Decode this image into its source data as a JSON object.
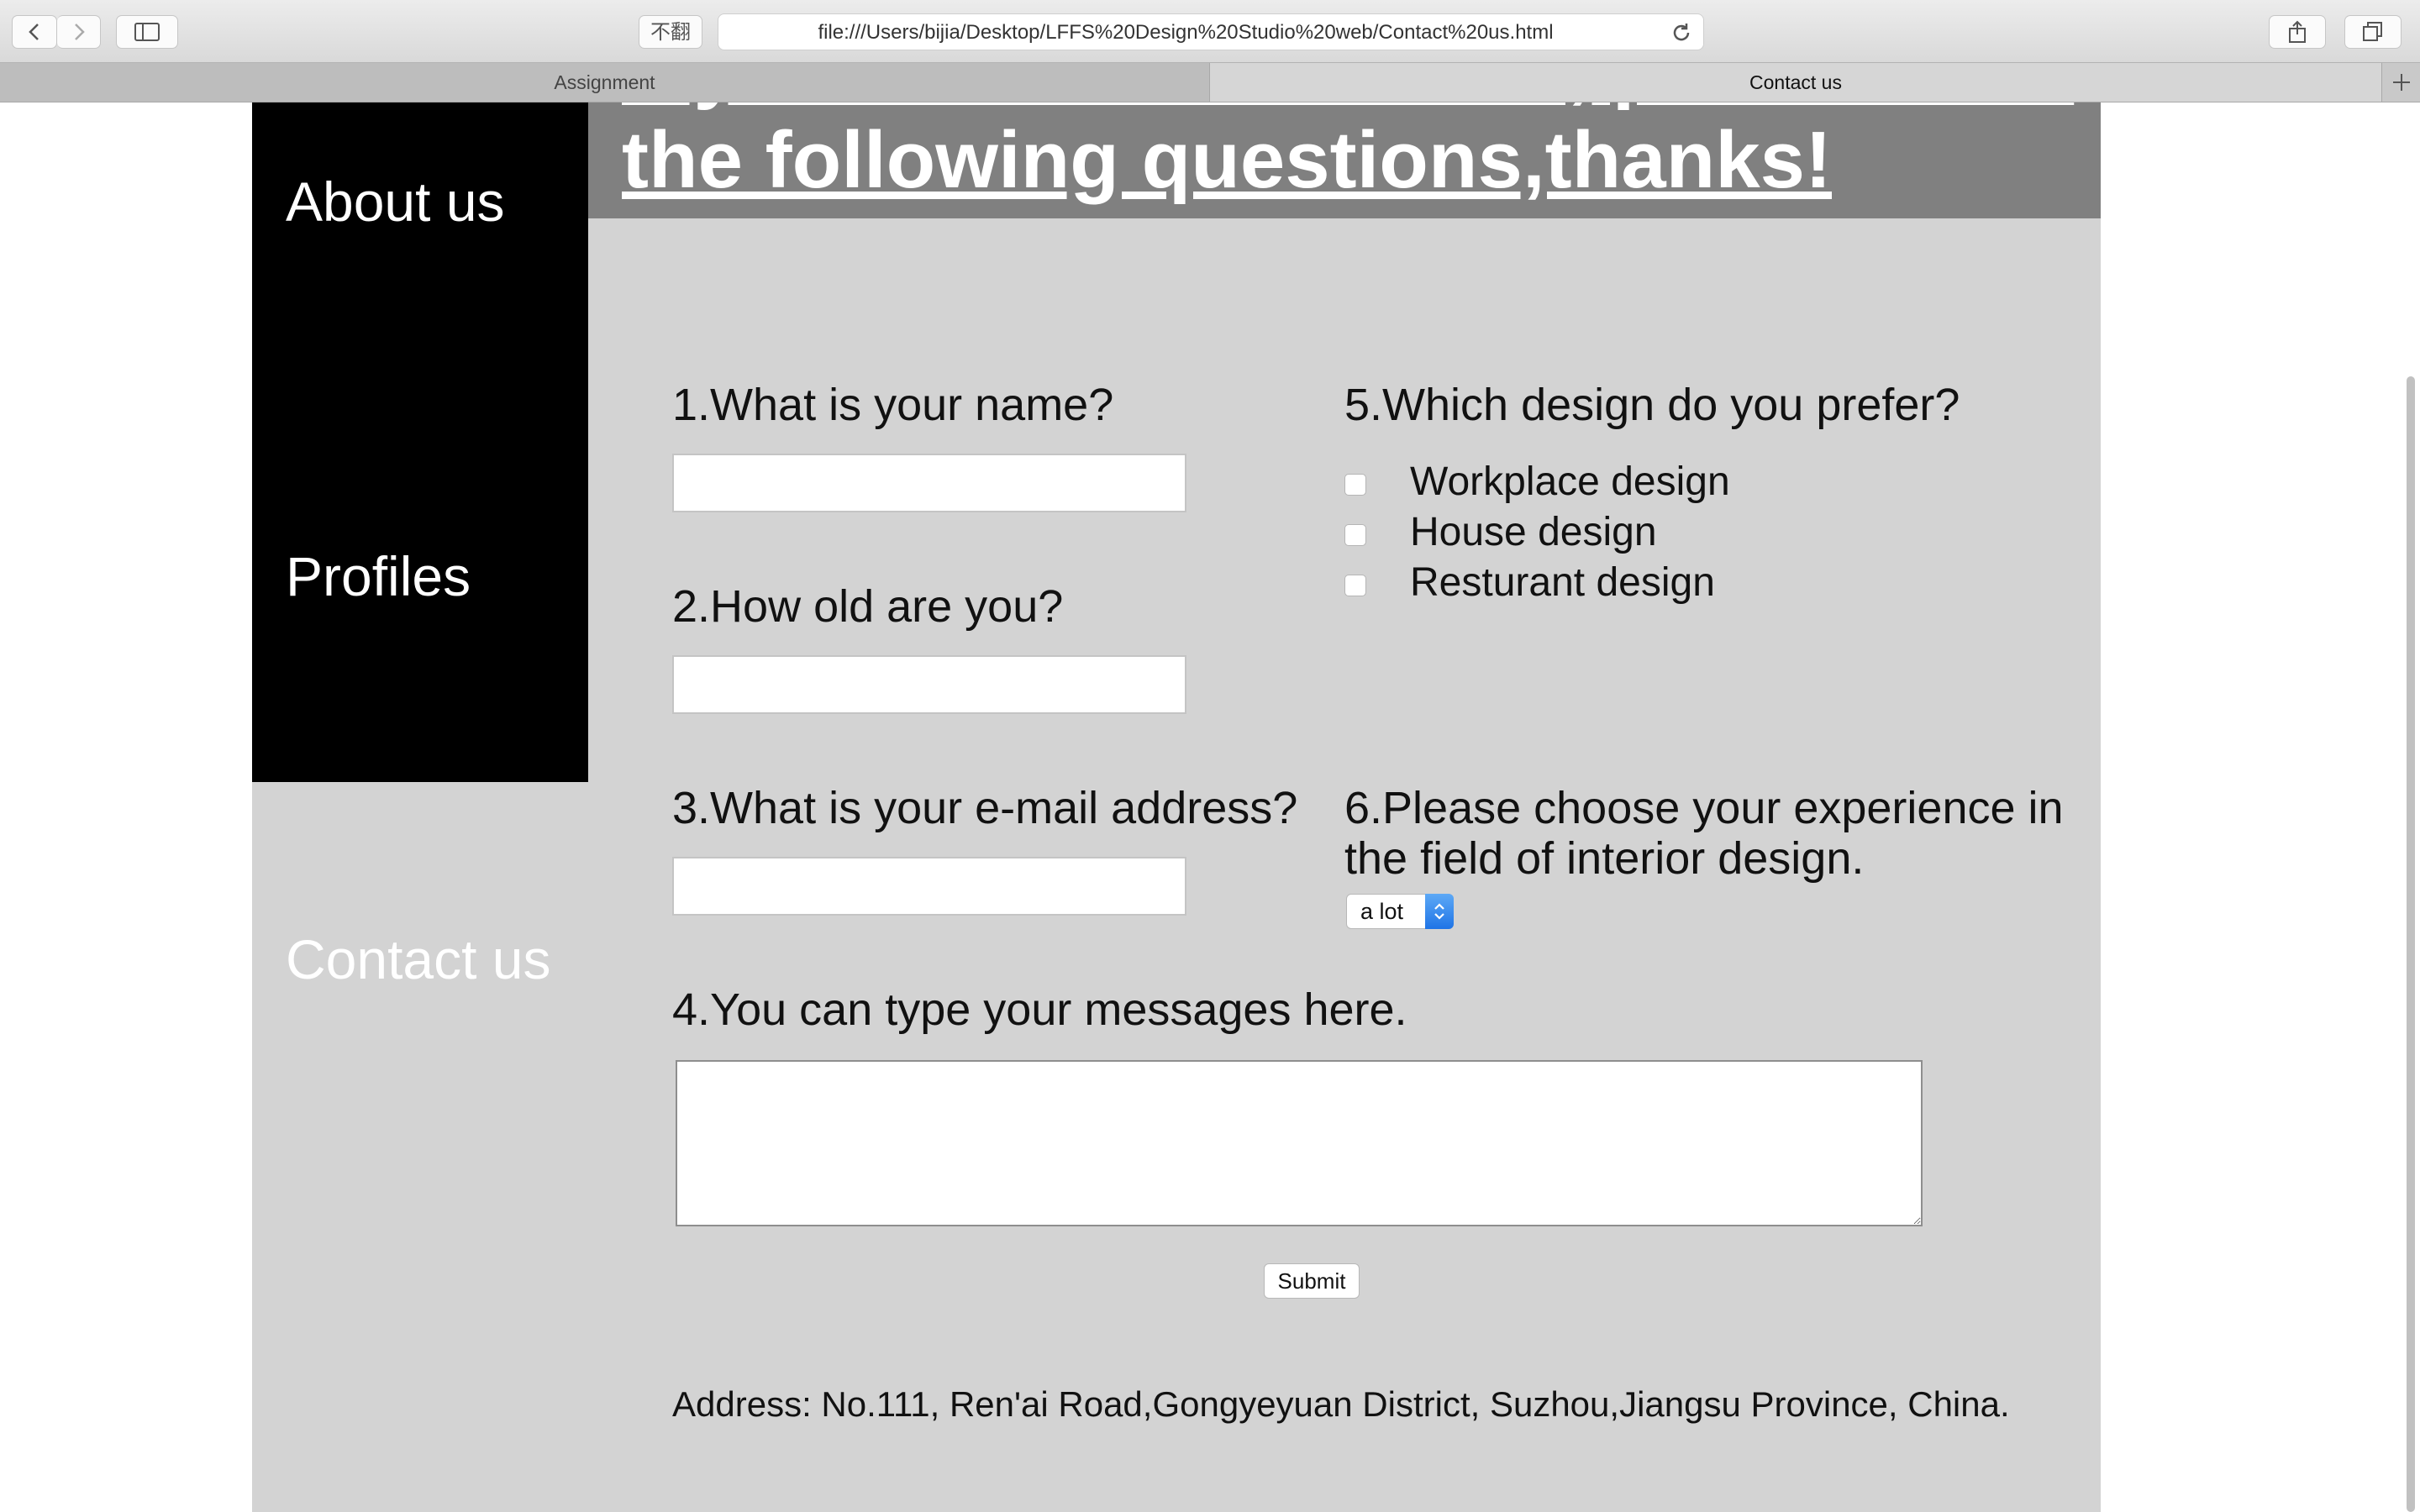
{
  "browser": {
    "url": "file:///Users/bijia/Desktop/LFFS%20Design%20Studio%20web/Contact%20us.html",
    "ext_label": "不翻",
    "tabs": [
      {
        "label": "Assignment",
        "active": false
      },
      {
        "label": "Contact us",
        "active": true
      }
    ]
  },
  "nav": {
    "about": "About us",
    "profiles": "Profiles",
    "contact": "Contact us"
  },
  "header": {
    "line1": "If you want to contact us, please fill in",
    "line2": "the following questions,thanks!"
  },
  "form": {
    "q1": "1.What is your name?",
    "q2": "2.How old are you?",
    "q3": "3.What is your e-mail address?",
    "q4": "4.You can type your messages here.",
    "q5": "5.Which design do you prefer?",
    "q5_options": [
      "Workplace design",
      "House design",
      "Resturant design"
    ],
    "q6": "6.Please choose your experience in the field of interior design.",
    "q6_selected": "a lot",
    "name_value": "",
    "age_value": "",
    "email_value": "",
    "message_value": "",
    "submit_label": "Submit"
  },
  "footer": {
    "address": "Address: No.111, Ren'ai Road,Gongyeyuan District, Suzhou,Jiangsu Province, China."
  },
  "colors": {
    "sidebar": "#000000",
    "page_bg": "#d3d3d3",
    "header_band": "#808080",
    "select_accent": "#2b7de9"
  }
}
